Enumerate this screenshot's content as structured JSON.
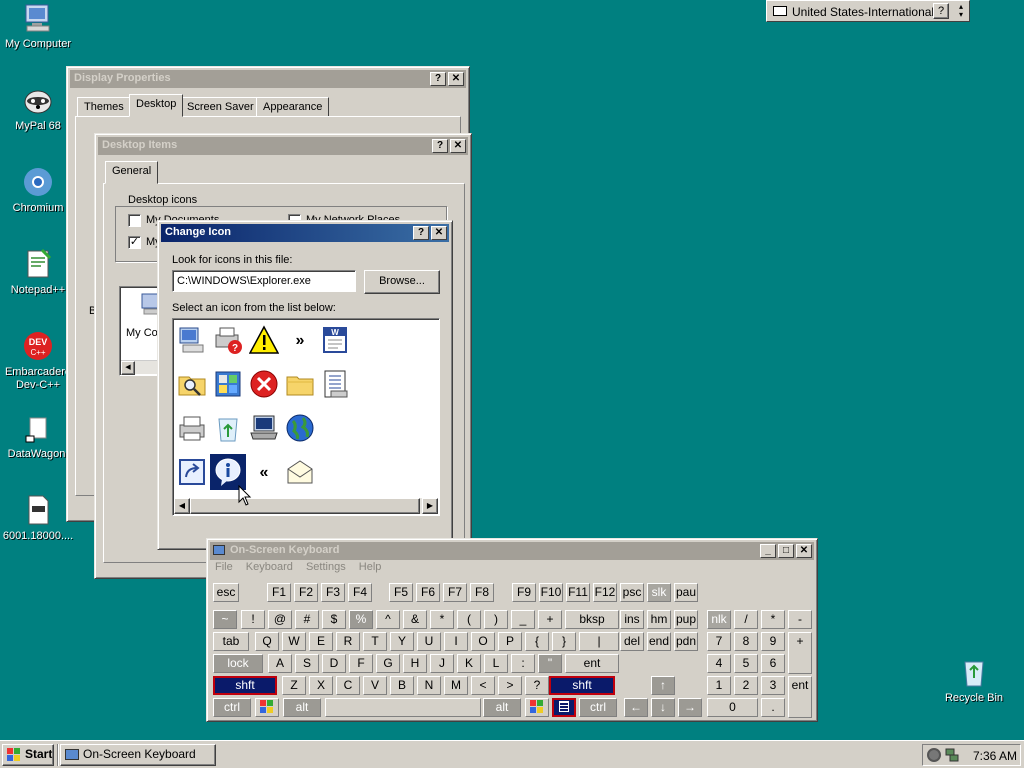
{
  "desktop": {
    "icons": [
      {
        "label": "My Computer"
      },
      {
        "label": "MyPal 68"
      },
      {
        "label": "Chromium"
      },
      {
        "label": "Notepad++"
      },
      {
        "label": "Embarcadero Dev-C++"
      },
      {
        "label": "DataWagon."
      },
      {
        "label": "6001.18000...."
      },
      {
        "label": "Recycle Bin"
      }
    ]
  },
  "language_bar": {
    "language": "United States-International",
    "help": "?"
  },
  "display_properties": {
    "title": "Display Properties",
    "tabs": [
      "Themes",
      "Desktop",
      "Screen Saver",
      "Appearance"
    ],
    "help_btn": "?",
    "close_btn": "✕",
    "partial_label": "B"
  },
  "desktop_items": {
    "title": "Desktop Items",
    "tab": "General",
    "group_label": "Desktop icons",
    "checks": [
      {
        "label": "My Documents",
        "checked": false
      },
      {
        "label": "My Network Places",
        "checked": false
      },
      {
        "label": "My",
        "checked": true
      }
    ],
    "preview_label": "My Co",
    "help_btn": "?",
    "close_btn": "✕"
  },
  "change_icon": {
    "title": "Change Icon",
    "look_label": "Look for icons in this file:",
    "file_value": "C:\\WINDOWS\\Explorer.exe",
    "browse": "Browse...",
    "select_label": "Select an icon from the list below:",
    "help_btn": "?",
    "close_btn": "✕",
    "icons": [
      "computer-icon",
      "printer-help-icon",
      "warning-icon",
      "forward-icon",
      "word-doc-icon",
      "folder-search-icon",
      "control-panel-icon",
      "error-icon",
      "folder-icon",
      "document-list-icon",
      "printer-icon",
      "recycle-icon",
      "laptop-icon",
      "globe-icon",
      "",
      "shortcut-icon",
      "info-icon",
      "back-icon",
      "mail-icon",
      ""
    ],
    "selected_index": 16
  },
  "osk": {
    "title": "On-Screen Keyboard",
    "menu": [
      "File",
      "Keyboard",
      "Settings",
      "Help"
    ],
    "row_fn": [
      "esc",
      "F1",
      "F2",
      "F3",
      "F4",
      "F5",
      "F6",
      "F7",
      "F8",
      "F9",
      "F10",
      "F11",
      "F12",
      "psc",
      "slk",
      "pau"
    ],
    "row_num": [
      "~",
      "!",
      "@",
      "#",
      "$",
      "%",
      "^",
      "&",
      "*",
      "(",
      ")",
      "_",
      "+",
      "bksp",
      "ins",
      "hm",
      "pup",
      "nlk",
      "/",
      "*",
      "-"
    ],
    "row_tab": [
      "tab",
      "Q",
      "W",
      "E",
      "R",
      "T",
      "Y",
      "U",
      "I",
      "O",
      "P",
      "{",
      "}",
      "|",
      "del",
      "end",
      "pdn",
      "7",
      "8",
      "9",
      "+"
    ],
    "row_lock": [
      "lock",
      "A",
      "S",
      "D",
      "F",
      "G",
      "H",
      "J",
      "K",
      "L",
      ":",
      "\"",
      "ent",
      "4",
      "5",
      "6"
    ],
    "row_shift": [
      "shft",
      "Z",
      "X",
      "C",
      "V",
      "B",
      "N",
      "M",
      "<",
      ">",
      "?",
      "shft",
      "↑",
      "1",
      "2",
      "3",
      "ent"
    ],
    "row_ctrl": [
      "ctrl",
      "alt",
      "alt",
      "ctrl",
      "←",
      "↓",
      "→",
      "0",
      "."
    ]
  },
  "taskbar": {
    "start": "Start",
    "task": "On-Screen Keyboard",
    "clock": "7:36 AM"
  }
}
